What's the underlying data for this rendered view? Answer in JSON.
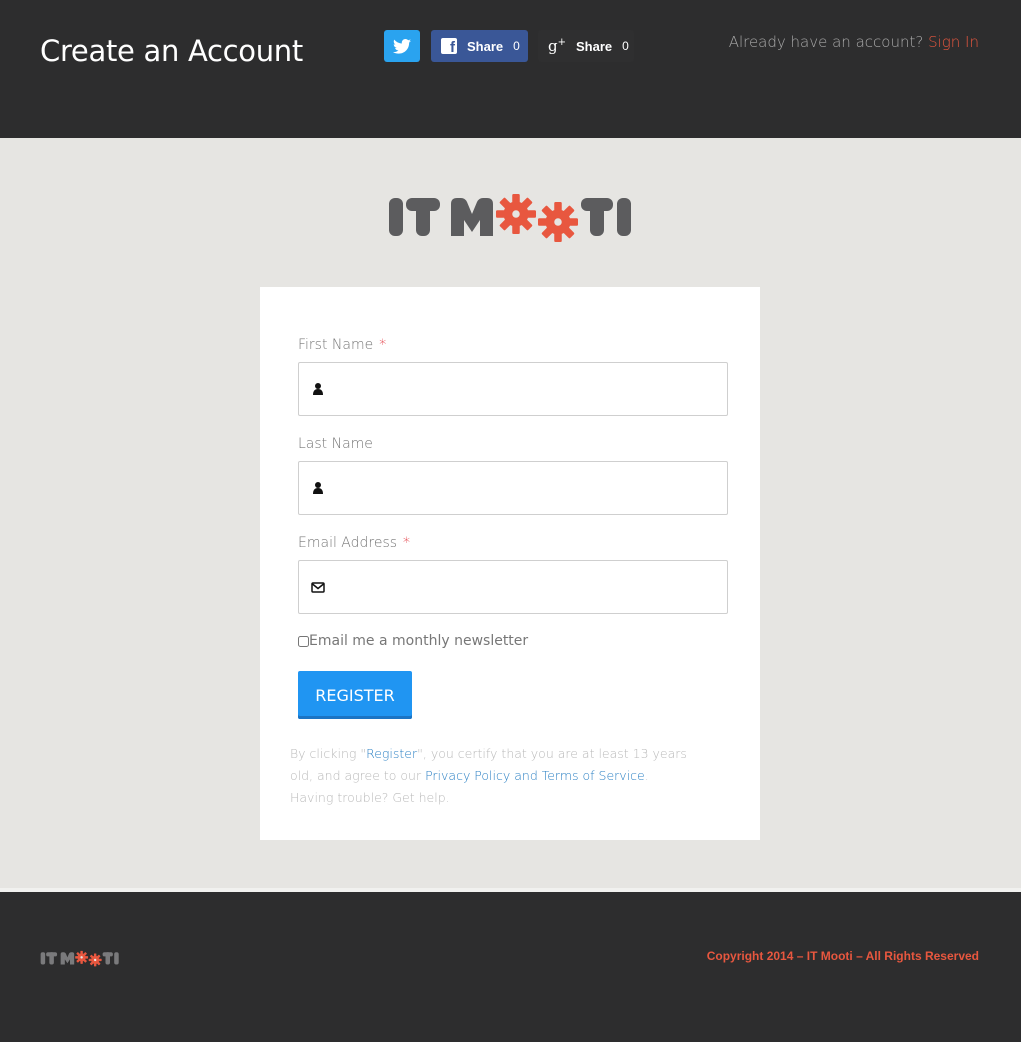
{
  "header": {
    "title": "Create an Account",
    "social": {
      "facebook_label": "Share",
      "facebook_count": "0",
      "google_label": "Share",
      "google_count": "0"
    },
    "signin_prompt": "Already have an account?",
    "signin_link": "Sign In"
  },
  "logo": {
    "text": "IT MOOTI"
  },
  "form": {
    "first_name": {
      "label": "First Name",
      "required_mark": "*",
      "icon": "user-icon",
      "value": ""
    },
    "last_name": {
      "label": "Last Name",
      "icon": "user-icon",
      "value": ""
    },
    "email": {
      "label": "Email Address",
      "required_mark": "*",
      "icon": "envelope-icon",
      "value": ""
    },
    "newsletter_label": "Email me a monthly newsletter",
    "newsletter_checked": false,
    "register_label": "REGISTER",
    "disclaimer": {
      "part1": "By clicking \"",
      "register_link": "Register",
      "part2": "\", you certify that you are at least 13 years old, and agree to our ",
      "policy_link": "Privacy Policy and Terms of Service",
      "part3": ". Having trouble? Get help."
    }
  },
  "footer": {
    "copyright": "Copyright 2014 – IT Mooti – All Rights Reserved"
  },
  "colors": {
    "header_bg": "#2d2d2e",
    "page_bg": "#e6e5e2",
    "accent_orange": "#e8573f",
    "register_blue": "#2095f2",
    "twitter_blue": "#2aa3ef",
    "facebook_blue": "#3a5797"
  }
}
